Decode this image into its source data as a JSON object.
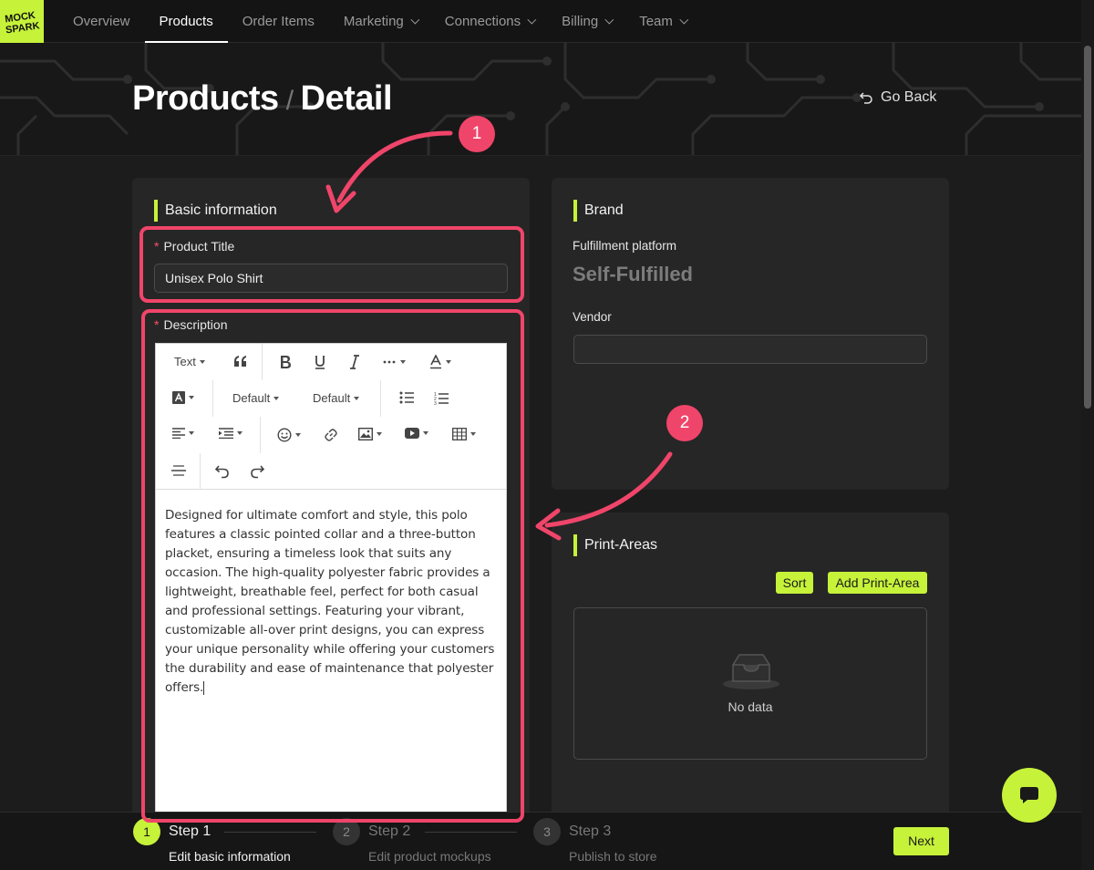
{
  "nav": {
    "logo_text": "MOCK SPARK",
    "items": [
      {
        "label": "Overview"
      },
      {
        "label": "Products"
      },
      {
        "label": "Order Items"
      },
      {
        "label": "Marketing"
      },
      {
        "label": "Connections"
      },
      {
        "label": "Billing"
      },
      {
        "label": "Team"
      }
    ],
    "active": "Products"
  },
  "header": {
    "title_part1": "Products",
    "separator": "/",
    "title_part2": "Detail",
    "go_back": "Go Back"
  },
  "basic_info": {
    "section_title": "Basic information",
    "required_mark": "*",
    "product_title_label": "Product Title",
    "product_title_value": "Unisex Polo Shirt",
    "description_label": "Description",
    "toolbar": {
      "text_dropdown": "Text",
      "font_family": "Default",
      "font_size": "Default"
    },
    "description_text": "Designed for ultimate comfort and style, this polo features a classic pointed collar and a three-button placket, ensuring a timeless look that suits any occasion. The high-quality polyester fabric provides a lightweight, breathable feel, perfect for both casual and professional settings. Featuring your vibrant, customizable all-over print designs, you can express your unique personality while offering your customers the durability and ease of maintenance that polyester offers."
  },
  "brand": {
    "section_title": "Brand",
    "platform_label": "Fulfillment platform",
    "platform_value": "Self-Fulfilled",
    "vendor_label": "Vendor",
    "vendor_value": ""
  },
  "print_areas": {
    "section_title": "Print-Areas",
    "sort_button": "Sort",
    "add_button": "Add Print-Area",
    "empty_text": "No data"
  },
  "steps": [
    {
      "number": "1",
      "title": "Step 1",
      "desc": "Edit basic information",
      "state": "active"
    },
    {
      "number": "2",
      "title": "Step 2",
      "desc": "Edit product mockups",
      "state": "pending"
    },
    {
      "number": "3",
      "title": "Step 3",
      "desc": "Publish to store",
      "state": "pending"
    }
  ],
  "next_button": "Next",
  "annotations": [
    {
      "number": "1"
    },
    {
      "number": "2"
    }
  ],
  "colors": {
    "accent": "#c6f23a",
    "annotation": "#f0456a",
    "background": "#1c1c1c",
    "card": "#262626"
  }
}
